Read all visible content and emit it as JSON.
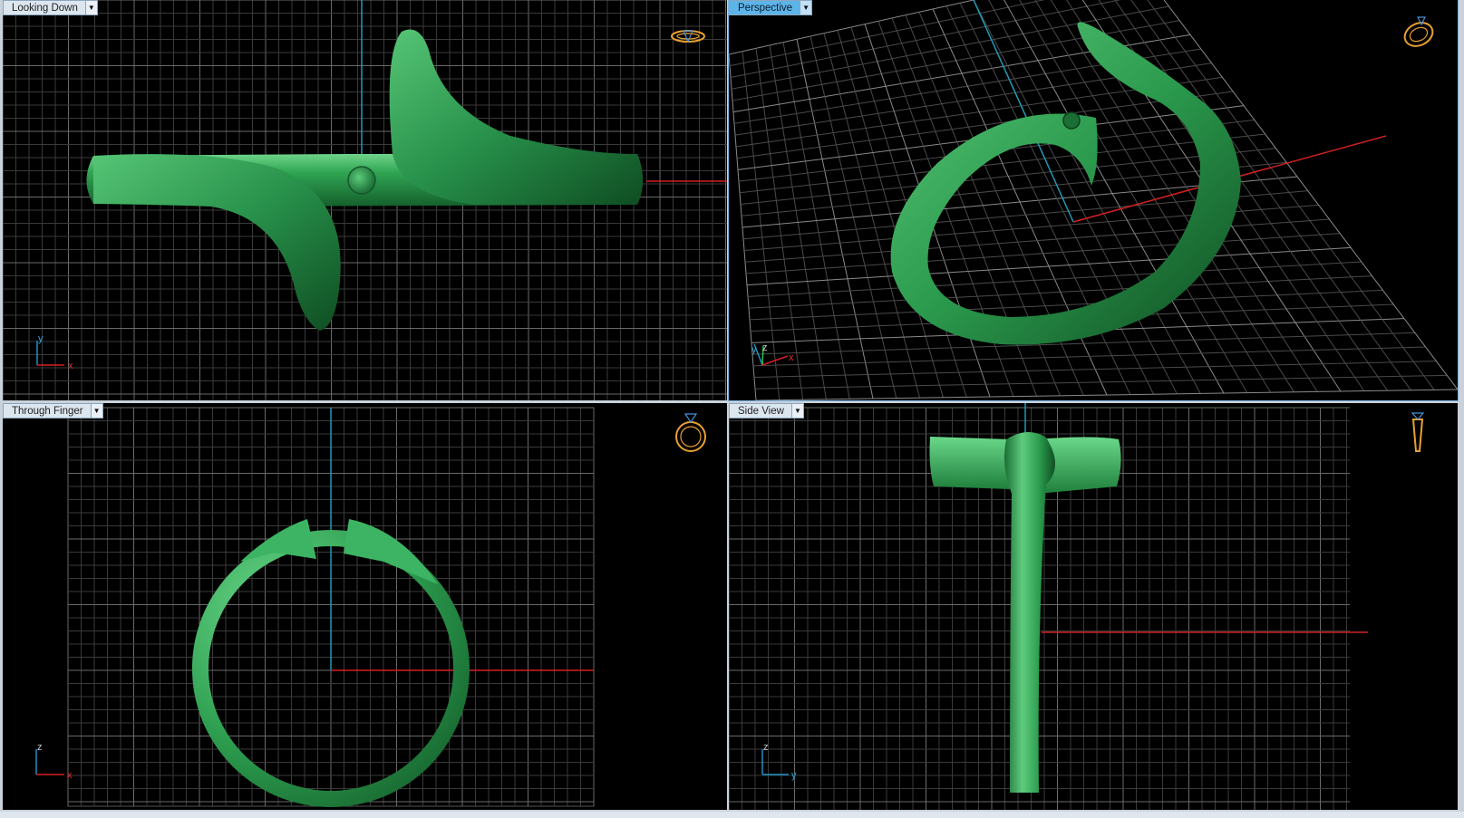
{
  "viewports": {
    "top": {
      "label": "Looking Down",
      "active": false,
      "axes": [
        "y",
        "x"
      ]
    },
    "perspective": {
      "label": "Perspective",
      "active": true,
      "axes": [
        "y",
        "z",
        "x"
      ]
    },
    "front": {
      "label": "Through Finger",
      "active": false,
      "axes": [
        "z",
        "x"
      ]
    },
    "side": {
      "label": "Side View",
      "active": false,
      "axes": [
        "z",
        "y"
      ]
    }
  },
  "icons": {
    "viewport_menu": "chevron-down-icon",
    "view_cube": "ring-view-icon"
  },
  "colors": {
    "model": "#2e9a4e",
    "grid": "#555555",
    "x_axis": "#d32020",
    "y_axis": "#1f9bb8",
    "active_label": "#5db4e8",
    "nav_icon": "#e8a030"
  }
}
